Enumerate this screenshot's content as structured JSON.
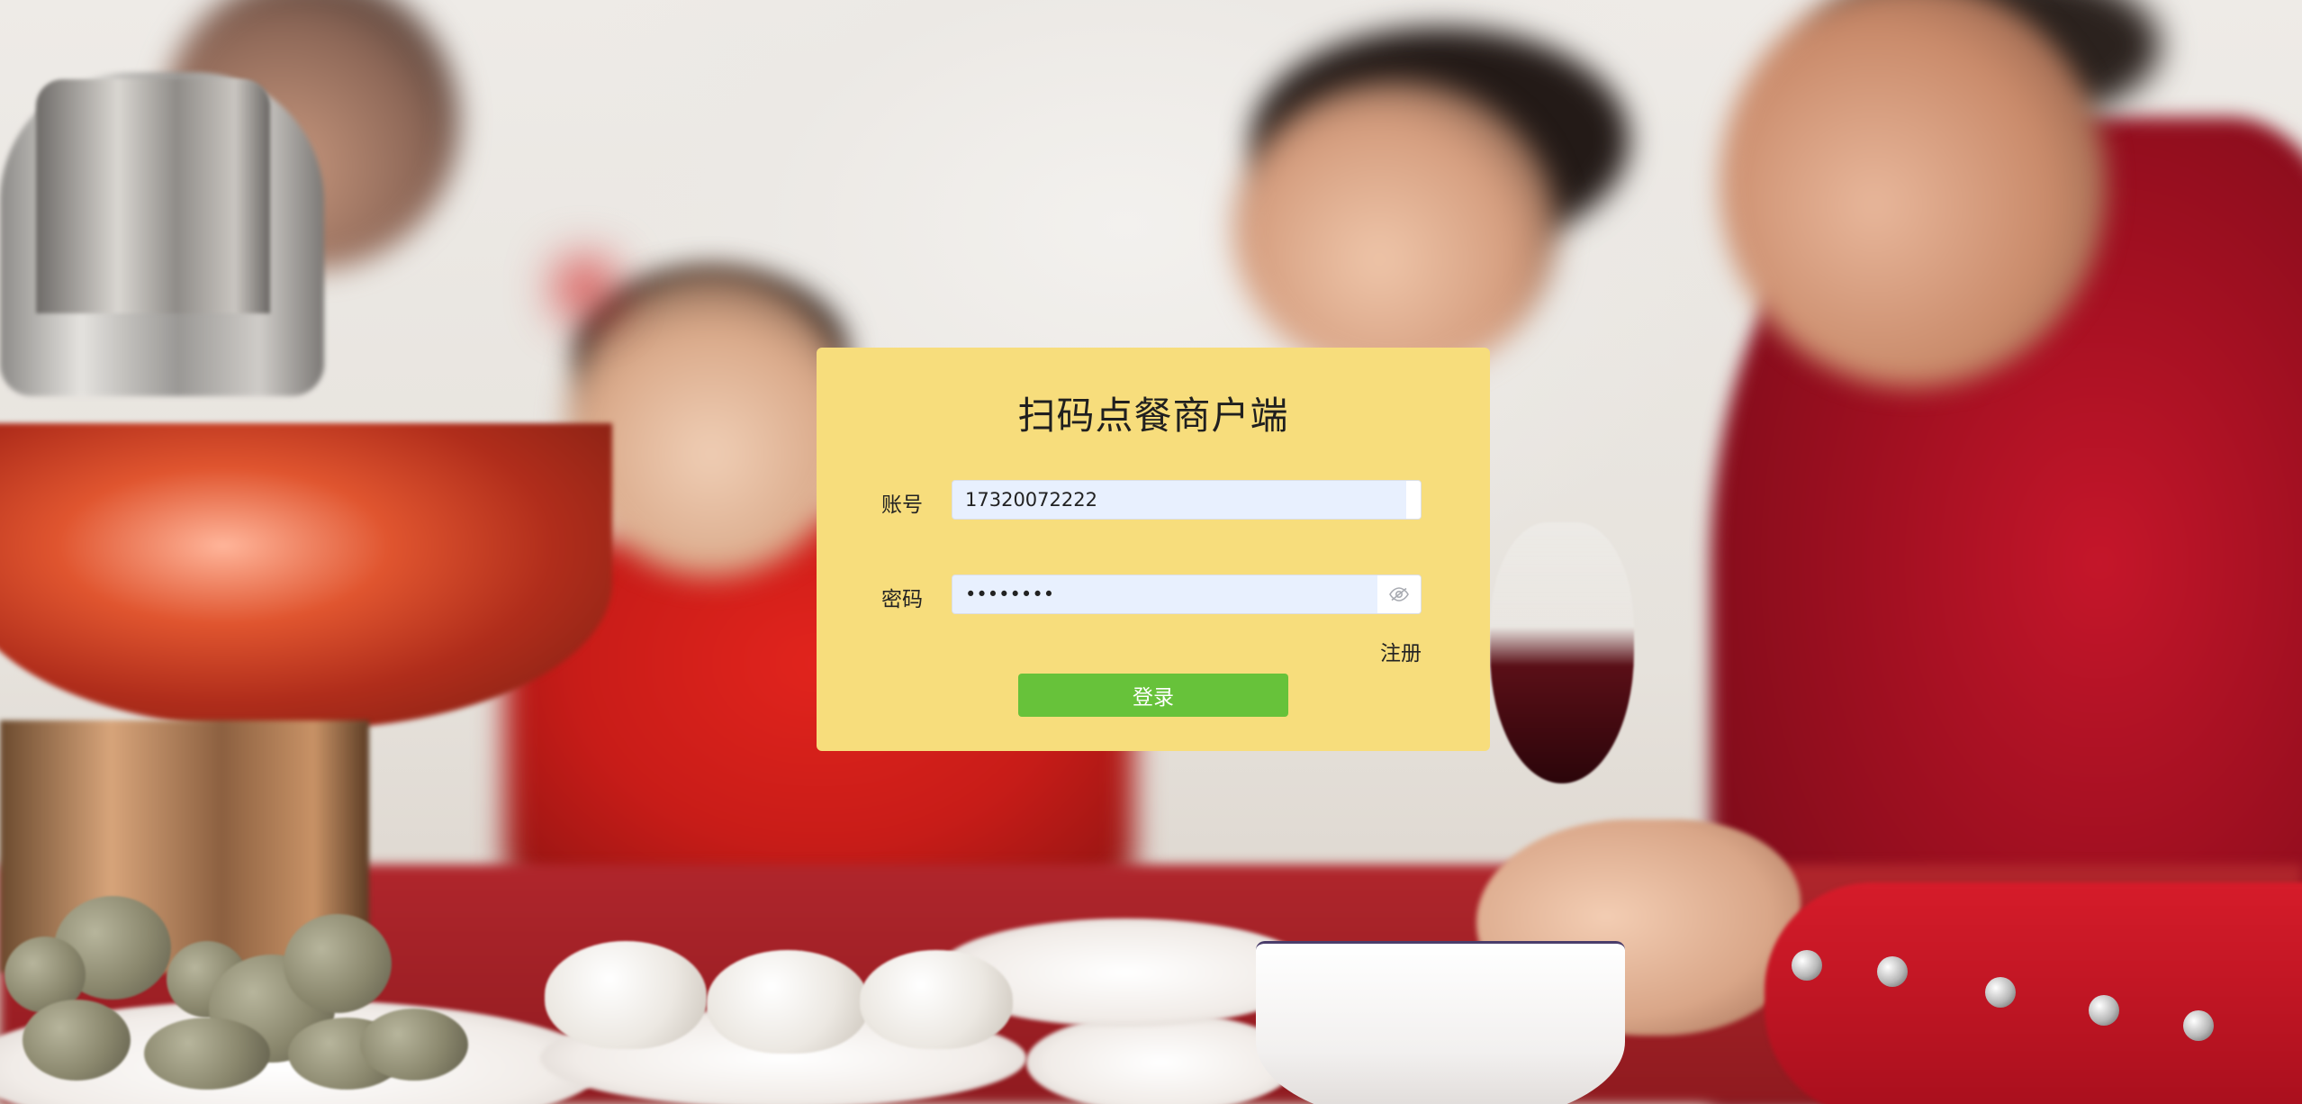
{
  "login": {
    "title": "扫码点餐商户端",
    "account_label": "账号",
    "account_value": "17320072222",
    "password_label": "密码",
    "password_value": "wxmenu22",
    "register_label": "注册",
    "login_button_label": "登录"
  },
  "icons": {
    "password_toggle": "eye-off-icon"
  },
  "colors": {
    "card_background": "#f7dd7c",
    "login_button": "#67c23a",
    "input_autofill": "#e8f0fe"
  }
}
